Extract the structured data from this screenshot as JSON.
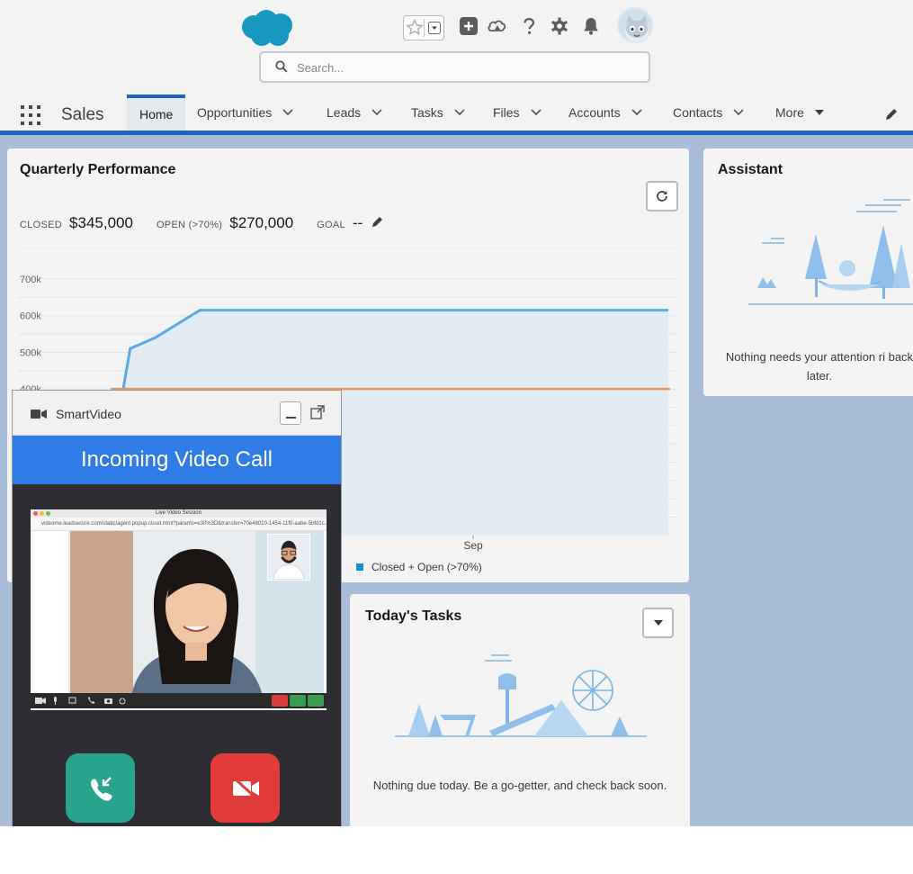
{
  "header": {
    "logo": "salesforce-cloud-logo",
    "search_placeholder": "Search...",
    "icons": [
      "favorites-star-icon",
      "chevron-down-icon",
      "add-icon",
      "trailhead-icon",
      "help-icon",
      "setup-gear-icon",
      "notifications-bell-icon",
      "avatar"
    ]
  },
  "nav": {
    "app_name": "Sales",
    "tabs": [
      {
        "label": "Home",
        "active": true
      },
      {
        "label": "Opportunities"
      },
      {
        "label": "Leads"
      },
      {
        "label": "Tasks"
      },
      {
        "label": "Files"
      },
      {
        "label": "Accounts"
      },
      {
        "label": "Contacts"
      },
      {
        "label": "More"
      }
    ]
  },
  "quarterly": {
    "title": "Quarterly Performance",
    "closed_label": "CLOSED",
    "closed_value": "$345,000",
    "open_label": "OPEN (>70%)",
    "open_value": "$270,000",
    "goal_label": "GOAL",
    "goal_value": "--",
    "legend": "Closed + Open (>70%)"
  },
  "chart_data": {
    "type": "area",
    "yticks": [
      "700k",
      "600k",
      "500k",
      "400k"
    ],
    "xticks": [
      "Sep"
    ],
    "ylim": [
      0,
      700000
    ],
    "series": [
      {
        "name": "Closed + Open (>70%)",
        "x": [
          0,
          0.035,
          0.08,
          0.16,
          1.0
        ],
        "values": [
          200000,
          510000,
          540000,
          615000,
          615000
        ]
      }
    ],
    "goal_line": 400000,
    "colors": {
      "line": "#5aabe4",
      "fill": "#e2ecf5",
      "goal": "#e8955a"
    }
  },
  "assistant": {
    "title": "Assistant",
    "message": "Nothing needs your attention ri back later."
  },
  "tasks": {
    "title": "Today's Tasks",
    "message": "Nothing due today. Be a go-getter, and check back soon."
  },
  "smartvideo": {
    "name": "SmartVideo",
    "banner": "Incoming Video Call",
    "window_title": "Live Video Session",
    "url": "videome.leadsecure.com/static/agent.popup.cloud.html?params=e30%3D&transfer=70e48010-1454-11f0-aabe-5bfd1c..."
  },
  "colors": {
    "brand_blue": "#1b65c2",
    "banner_blue": "#2f7be8",
    "accept_green": "#27a38e",
    "decline_red": "#e23b3b",
    "page_bg": "#a9bdd9"
  }
}
